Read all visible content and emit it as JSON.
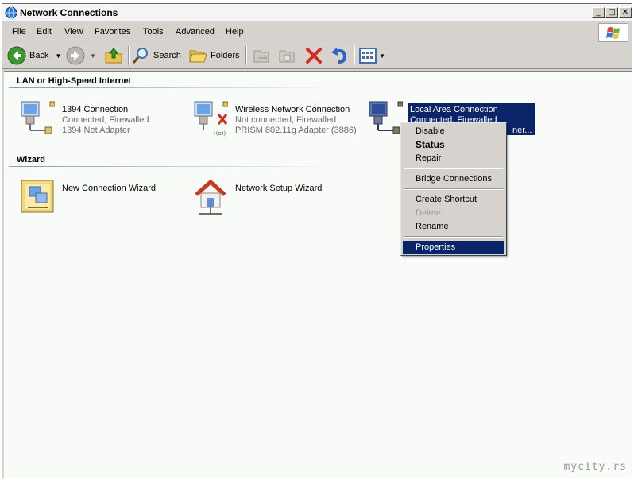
{
  "window": {
    "title": "Network Connections"
  },
  "menubar": {
    "items": [
      "File",
      "Edit",
      "View",
      "Favorites",
      "Tools",
      "Advanced",
      "Help"
    ]
  },
  "toolbar": {
    "back_label": "Back",
    "search_label": "Search",
    "folders_label": "Folders"
  },
  "groups": {
    "lan": {
      "header": "LAN or High-Speed Internet",
      "items": [
        {
          "name": "1394 Connection",
          "status": "Connected, Firewalled",
          "device": "1394 Net Adapter"
        },
        {
          "name": "Wireless Network Connection",
          "status": "Not connected, Firewalled",
          "device": "PRISM 802.11g Adapter (3886)"
        },
        {
          "name": "Local Area Connection",
          "status": "Connected, Firewalled",
          "device": "ner..."
        }
      ]
    },
    "wizard": {
      "header": "Wizard",
      "items": [
        {
          "name": "New Connection Wizard"
        },
        {
          "name": "Network Setup Wizard"
        }
      ]
    }
  },
  "context_menu": {
    "items": [
      {
        "label": "Disable"
      },
      {
        "label": "Status"
      },
      {
        "label": "Repair"
      },
      {
        "label": "Bridge Connections"
      },
      {
        "label": "Create Shortcut"
      },
      {
        "label": "Delete"
      },
      {
        "label": "Rename"
      },
      {
        "label": "Properties"
      }
    ]
  },
  "watermark": "mycity.rs",
  "colors": {
    "selection": "#0a246a",
    "content_bg": "#f9fbf9",
    "chrome": "#d6d3ce"
  }
}
